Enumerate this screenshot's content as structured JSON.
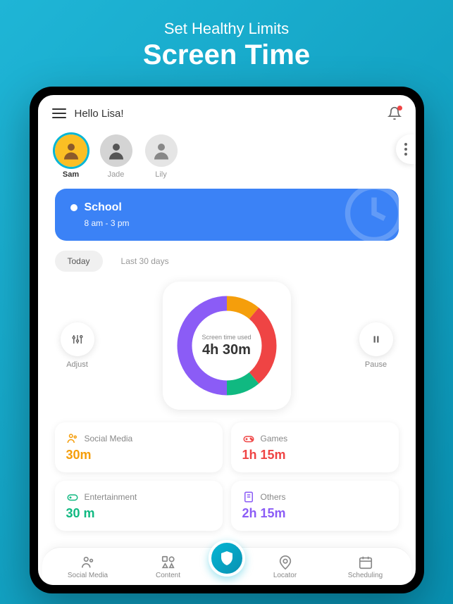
{
  "promo": {
    "subtitle": "Set Healthy Limits",
    "title": "Screen Time"
  },
  "header": {
    "greeting": "Hello Lisa!"
  },
  "profiles": [
    {
      "name": "Sam",
      "active": true,
      "bg": "#fbbf24"
    },
    {
      "name": "Jade",
      "active": false,
      "bg": "#d4d4d4"
    },
    {
      "name": "Lily",
      "active": false,
      "bg": "#e5e5e5"
    }
  ],
  "status": {
    "title": "School",
    "time": "8 am - 3 pm"
  },
  "tabs": [
    {
      "label": "Today",
      "active": true
    },
    {
      "label": "Last 30 days",
      "active": false
    }
  ],
  "sidebuttons": {
    "left": "Adjust",
    "right": "Pause"
  },
  "gauge": {
    "label": "Screen time used",
    "value": "4h 30m"
  },
  "chart_data": {
    "type": "pie",
    "title": "Screen time used",
    "total_label": "4h 30m",
    "total_minutes": 270,
    "series": [
      {
        "name": "Social Media",
        "label": "30m",
        "minutes": 30,
        "color": "#f59e0b"
      },
      {
        "name": "Games",
        "label": "1h 15m",
        "minutes": 75,
        "color": "#ef4444"
      },
      {
        "name": "Entertainment",
        "label": "30 m",
        "minutes": 30,
        "color": "#10b981"
      },
      {
        "name": "Others",
        "label": "2h 15m",
        "minutes": 135,
        "color": "#8b5cf6"
      }
    ]
  },
  "cards": [
    {
      "title": "Social Media",
      "value": "30m",
      "color": "orange"
    },
    {
      "title": "Games",
      "value": "1h 15m",
      "color": "red"
    },
    {
      "title": "Entertainment",
      "value": "30 m",
      "color": "green"
    },
    {
      "title": "Others",
      "value": "2h 15m",
      "color": "purple"
    }
  ],
  "nav": [
    {
      "label": "Social Media"
    },
    {
      "label": "Content"
    },
    {
      "label": "Locator"
    },
    {
      "label": "Scheduling"
    }
  ]
}
